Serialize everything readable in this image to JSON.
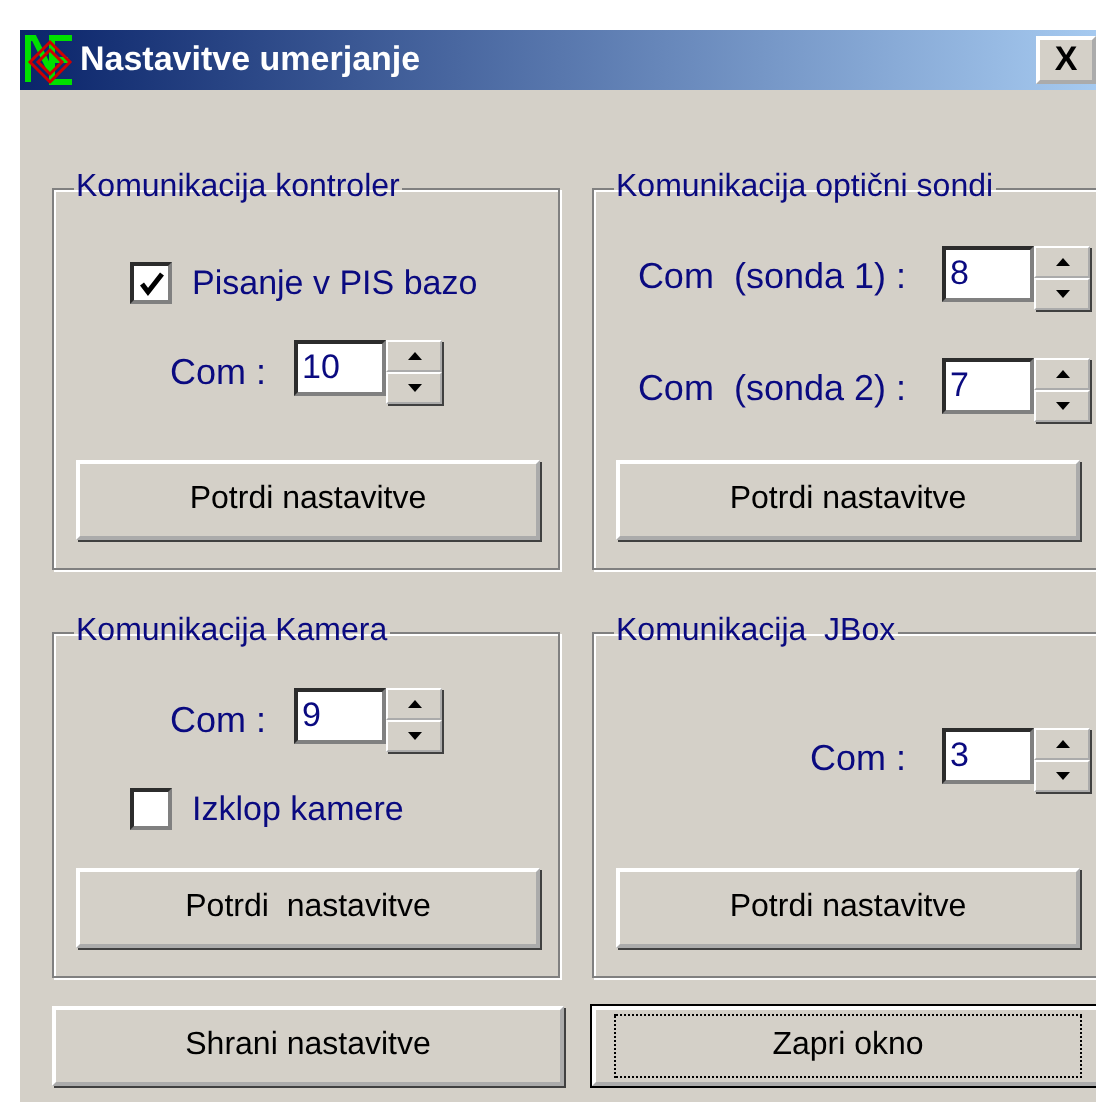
{
  "window": {
    "title": "Nastavitve umerjanje",
    "close": "X"
  },
  "groups": [
    {
      "title": "Komunikacija kontroler",
      "items": [
        {
          "kind": "checkbox",
          "label": "Pisanje v PIS bazo",
          "checked": true
        },
        {
          "kind": "spin",
          "label": "Com :",
          "value": "10"
        },
        {
          "kind": "button",
          "label": "Potrdi nastavitve"
        }
      ]
    },
    {
      "title": "Komunikacija optični sondi",
      "items": [
        {
          "kind": "spin",
          "label": "Com  (sonda 1) :",
          "value": "8"
        },
        {
          "kind": "spin",
          "label": "Com  (sonda 2) :",
          "value": "7"
        },
        {
          "kind": "button",
          "label": "Potrdi nastavitve"
        }
      ]
    },
    {
      "title": "Komunikacija Kamera",
      "items": [
        {
          "kind": "spin",
          "label": "Com :",
          "value": "9"
        },
        {
          "kind": "checkbox",
          "label": "Izklop kamere",
          "checked": false
        },
        {
          "kind": "button",
          "label": "Potrdi  nastavitve"
        }
      ]
    },
    {
      "title": "Komunikacija  JBox",
      "items": [
        {
          "kind": "spin",
          "label": "Com :",
          "value": "3"
        },
        {
          "kind": "button",
          "label": "Potrdi nastavitve"
        }
      ]
    }
  ],
  "buttons": [
    {
      "label": "Shrani nastavitve",
      "focused": false
    },
    {
      "label": "Zapri okno",
      "focused": true
    }
  ]
}
